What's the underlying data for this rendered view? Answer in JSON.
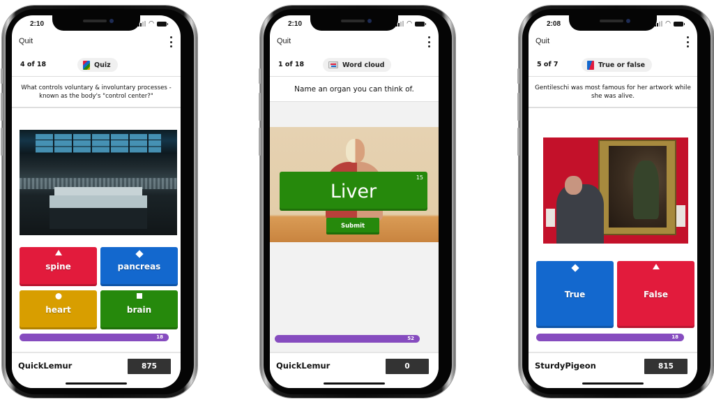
{
  "phones": [
    {
      "status": {
        "time": "2:10"
      },
      "top_bar": {
        "quit_label": "Quit",
        "menu_icon": "kebab-menu-icon"
      },
      "info": {
        "counter": "4 of 18",
        "type_label": "Quiz",
        "type_icon": "quiz-icon"
      },
      "question": "What controls voluntary & involuntary processes - known as the body's \"control center?\"",
      "image_alt": "control room",
      "answers": [
        {
          "label": "spine",
          "shape": "triangle",
          "color": "#e21b3c"
        },
        {
          "label": "pancreas",
          "shape": "diamond",
          "color": "#1368ce"
        },
        {
          "label": "heart",
          "shape": "circle",
          "color": "#d89e00"
        },
        {
          "label": "brain",
          "shape": "square",
          "color": "#26890c"
        }
      ],
      "timer": {
        "value": "18",
        "fraction": 0.92
      },
      "footer": {
        "nickname": "QuickLemur",
        "score": "875"
      }
    },
    {
      "status": {
        "time": "2:10"
      },
      "top_bar": {
        "quit_label": "Quit",
        "menu_icon": "kebab-menu-icon"
      },
      "info": {
        "counter": "1 of 18",
        "type_label": "Word cloud",
        "type_icon": "word-cloud-icon"
      },
      "question": "Name an organ you can think of.",
      "image_alt": "human anatomy torso model",
      "word_input": {
        "value": "Liver",
        "chars_remaining": "15",
        "color": "#26890c"
      },
      "submit_label": "Submit",
      "timer": {
        "value": "52",
        "fraction": 0.92
      },
      "footer": {
        "nickname": "QuickLemur",
        "score": "0"
      }
    },
    {
      "status": {
        "time": "2:08"
      },
      "top_bar": {
        "quit_label": "Quit",
        "menu_icon": "kebab-menu-icon"
      },
      "info": {
        "counter": "5 of 7",
        "type_label": "True or false",
        "type_icon": "true-false-icon"
      },
      "question": "Gentileschi was most famous for her artwork while she was alive.",
      "image_alt": "man hanging painting in gallery",
      "answers": [
        {
          "label": "True",
          "shape": "diamond",
          "color": "#1368ce"
        },
        {
          "label": "False",
          "shape": "triangle",
          "color": "#e21b3c"
        }
      ],
      "timer": {
        "value": "18",
        "fraction": 0.92
      },
      "footer": {
        "nickname": "SturdyPigeon",
        "score": "815"
      }
    }
  ],
  "colors": {
    "timer": "#864cbf",
    "score_bg": "#333333",
    "red": "#e21b3c",
    "blue": "#1368ce",
    "yellow": "#d89e00",
    "green": "#26890c"
  }
}
